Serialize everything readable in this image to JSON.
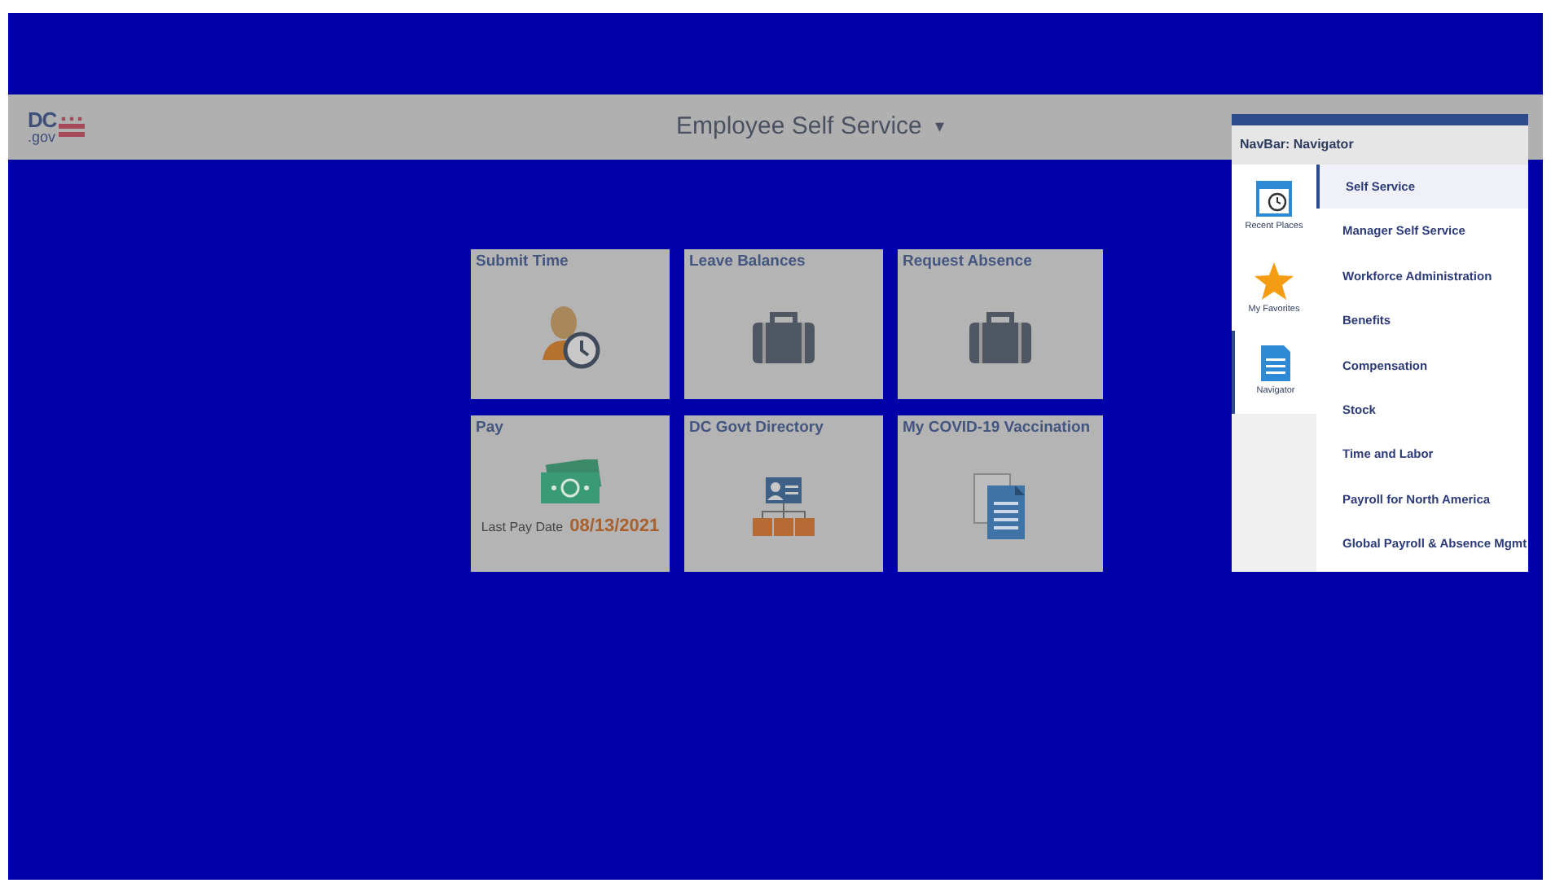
{
  "header": {
    "logo": {
      "text": "DC",
      "sub": ".gov"
    },
    "title": "Employee Self Service",
    "caret": "▾"
  },
  "tiles": [
    {
      "title": "Submit Time",
      "kind": "person-clock"
    },
    {
      "title": "Leave Balances",
      "kind": "briefcase"
    },
    {
      "title": "Request Absence",
      "kind": "briefcase"
    },
    {
      "title": "Pay",
      "kind": "money",
      "caption": "Last Pay Date",
      "value": "08/13/2021"
    },
    {
      "title": "DC Govt Directory",
      "kind": "org"
    },
    {
      "title": "My COVID-19 Vaccination",
      "kind": "document"
    }
  ],
  "navbar": {
    "title": "NavBar: Navigator",
    "side": [
      {
        "label": "Recent Places",
        "kind": "calendar",
        "selected": false
      },
      {
        "label": "My Favorites",
        "kind": "star",
        "selected": false
      },
      {
        "label": "Navigator",
        "kind": "document",
        "selected": true
      }
    ],
    "items": [
      {
        "label": "Self Service",
        "selected": true
      },
      {
        "label": "Manager Self Service",
        "selected": false
      },
      {
        "label": "Workforce Administration",
        "selected": false
      },
      {
        "label": "Benefits",
        "selected": false
      },
      {
        "label": "Compensation",
        "selected": false
      },
      {
        "label": "Stock",
        "selected": false
      },
      {
        "label": "Time and Labor",
        "selected": false
      },
      {
        "label": "Payroll for North America",
        "selected": false
      },
      {
        "label": "Global Payroll & Absence Mgmt",
        "selected": false
      }
    ]
  }
}
